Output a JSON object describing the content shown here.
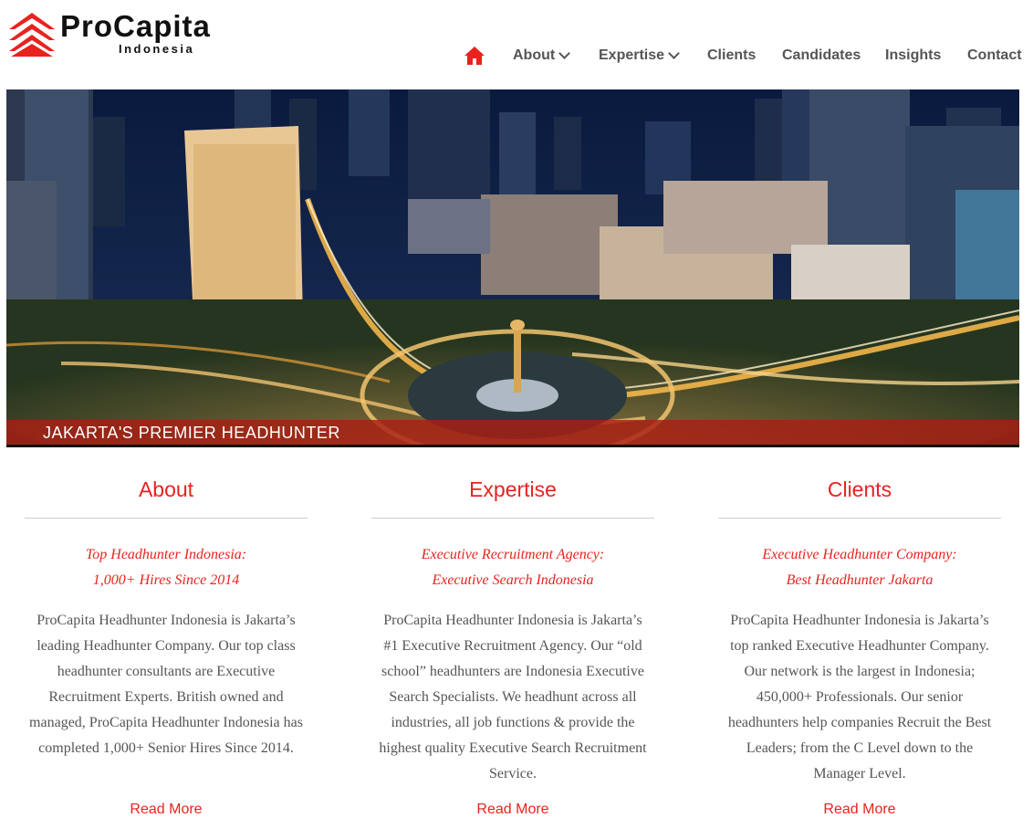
{
  "brand": {
    "name": "ProCapita",
    "subtitle": "Indonesia",
    "accent": "#e8231e"
  },
  "nav": {
    "home_icon": "home-icon",
    "items": [
      {
        "label": "About",
        "has_dropdown": true
      },
      {
        "label": "Expertise",
        "has_dropdown": true
      },
      {
        "label": "Clients",
        "has_dropdown": false
      },
      {
        "label": "Candidates",
        "has_dropdown": false
      },
      {
        "label": "Insights",
        "has_dropdown": false
      },
      {
        "label": "Contact",
        "has_dropdown": false
      }
    ]
  },
  "hero": {
    "caption": "JAKARTA'S PREMIER HEADHUNTER"
  },
  "columns": [
    {
      "title": "About",
      "subtitle_1": "Top Headhunter Indonesia:",
      "subtitle_2": "1,000+ Hires Since 2014",
      "body": "ProCapita Headhunter Indonesia is Jakarta’s leading Headhunter Company. Our top class headhunter consultants are Executive Recruitment Experts. British owned and managed, ProCapita Headhunter Indonesia has completed 1,000+ Senior Hires Since 2014.",
      "link": "Read More"
    },
    {
      "title": "Expertise",
      "subtitle_1": "Executive Recruitment Agency:",
      "subtitle_2": "Executive Search Indonesia",
      "body": "ProCapita Headhunter Indonesia is Jakarta’s #1 Executive Recruitment Agency. Our “old school” headhunters are Indonesia Executive Search Specialists. We headhunt across all industries, all job functions & provide the highest quality Executive Search Recruitment Service.",
      "link": "Read More"
    },
    {
      "title": "Clients",
      "subtitle_1": "Executive Headhunter Company:",
      "subtitle_2": "Best Headhunter Jakarta",
      "body": "ProCapita Headhunter Indonesia is Jakarta’s top ranked Executive Headhunter Company. Our network is the largest in Indonesia; 450,000+ Professionals. Our senior headhunters help companies Recruit the Best Leaders; from the C Level down to the Manager Level.",
      "link": "Read More"
    }
  ]
}
